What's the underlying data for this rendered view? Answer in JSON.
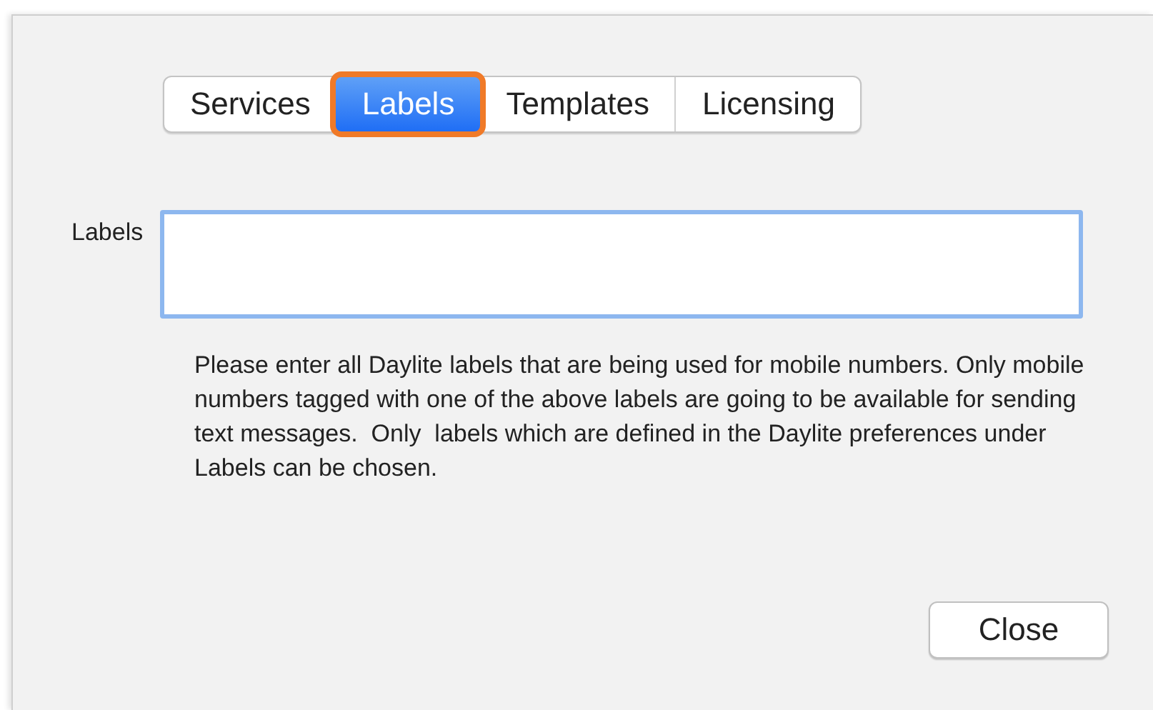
{
  "tabs": [
    {
      "label": "Services",
      "selected": false
    },
    {
      "label": "Labels",
      "selected": true
    },
    {
      "label": "Templates",
      "selected": false
    },
    {
      "label": "Licensing",
      "selected": false
    }
  ],
  "labels_field": {
    "label": "Labels"
  },
  "help_text": "Please enter all Daylite labels that are being used for mobile numbers. Only mobile numbers tagged with one of the above labels are going to be available for sending text messages.  Only  labels which are defined in the Daylite preferences under Labels can be chosen.",
  "buttons": [
    "Close"
  ]
}
